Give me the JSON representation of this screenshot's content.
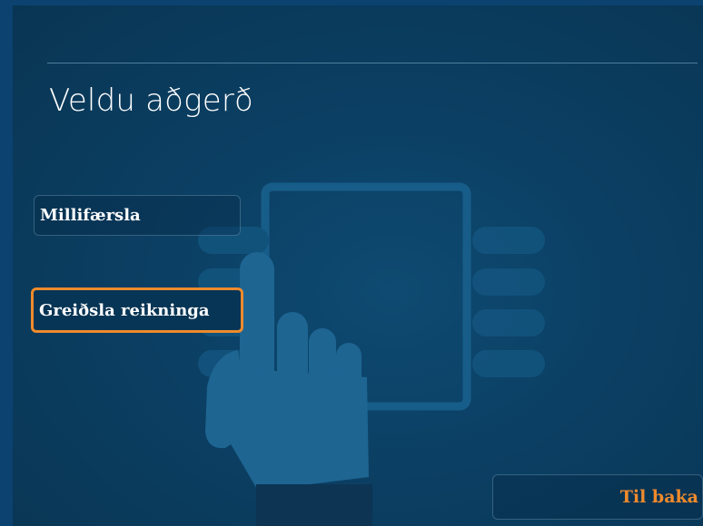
{
  "screen": {
    "title": "Veldu aðgerð"
  },
  "options": [
    {
      "label": "Millifærsla"
    },
    {
      "label": "Greiðsla reikninga",
      "selected": true
    }
  ],
  "back": {
    "label": "Til baka"
  },
  "colors": {
    "background": "#0b3f63",
    "accent": "#ef8a2c",
    "text": "#ffffff"
  },
  "illustration": {
    "icon": "hand-pressing-atm-icon"
  }
}
